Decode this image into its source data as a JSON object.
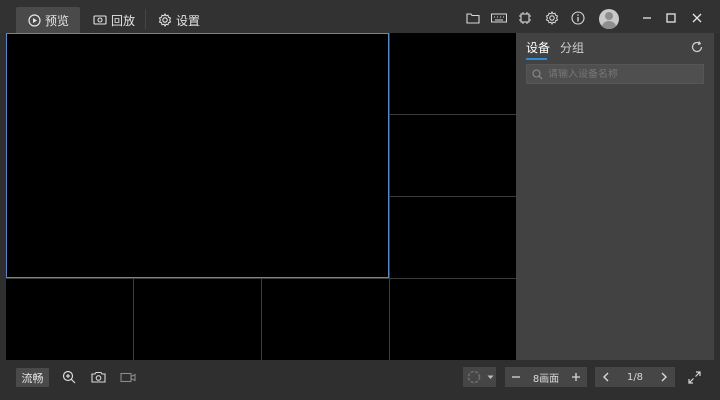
{
  "topbar": {
    "tabs": [
      {
        "label": "预览",
        "icon": "play-circle-icon",
        "active": true
      },
      {
        "label": "回放",
        "icon": "camera-playback-icon",
        "active": false
      },
      {
        "label": "设置",
        "icon": "gear-icon",
        "active": false
      }
    ],
    "tool_icons": [
      "folder-icon",
      "keyboard-icon",
      "chip-icon",
      "settings-icon",
      "info-icon",
      "avatar"
    ],
    "window_controls": [
      "minimize-icon",
      "maximize-icon",
      "close-icon"
    ]
  },
  "grid": {
    "layout": "8画面",
    "selected_cell": 0,
    "cells": 8
  },
  "panel": {
    "tabs": [
      {
        "label": "设备",
        "active": true
      },
      {
        "label": "分组",
        "active": false
      }
    ],
    "search_placeholder": "请输入设备名称"
  },
  "bottombar": {
    "stream_label": "流畅",
    "tools": [
      "zoom-in-icon",
      "snapshot-icon",
      "record-icon"
    ],
    "split_label": "8画面",
    "page_label": "1/8"
  },
  "colors": {
    "accent": "#2e8bd8",
    "selection_border": "#5a87c8",
    "background": "#2f2f2f",
    "panel": "#424242"
  }
}
